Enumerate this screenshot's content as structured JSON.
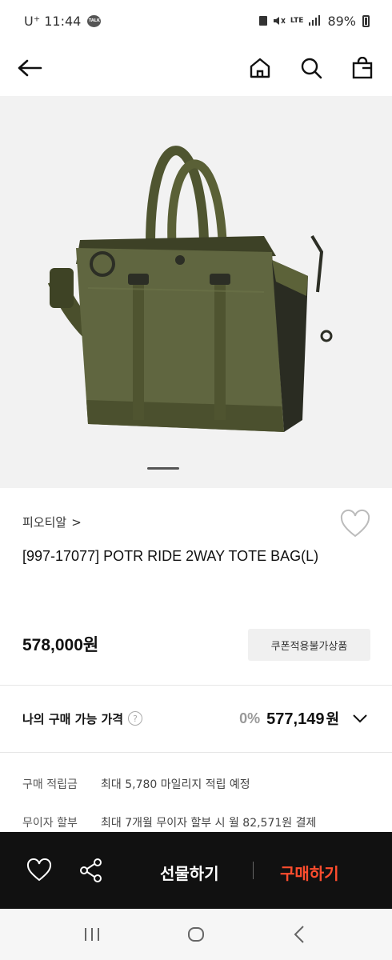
{
  "status_bar": {
    "carrier_time": "U⁺ 11:44",
    "talk_icon": "TALK",
    "network": "LTE",
    "battery": "89%"
  },
  "header": {
    "icons": [
      "back-arrow-icon",
      "home-icon",
      "search-icon",
      "shopping-bag-icon"
    ]
  },
  "product": {
    "brand": "피오티알",
    "brand_chevron": ">",
    "title": "[997-17077] POTR RIDE 2WAY TOTE BAG(L)",
    "price": "578,000원",
    "coupon_badge": "쿠폰적용불가상품",
    "bag_color": "#5e6339"
  },
  "my_price": {
    "label": "나의 구매 가능 가격",
    "help": "?",
    "discount": "0%",
    "value": "577,149",
    "unit": "원"
  },
  "info_rows": [
    {
      "label": "구매 적립금",
      "value": "최대 5,780 마일리지 적립 예정"
    },
    {
      "label": "무이자 할부",
      "value": "최대 7개월 무이자 할부 시 월 82,571원 결제"
    }
  ],
  "actions": {
    "gift": "선물하기",
    "buy": "구매하기",
    "buy_color": "#ff4d2e"
  },
  "nav": {
    "icons": [
      "recent-apps-icon",
      "home-circle-icon",
      "back-chevron-icon"
    ]
  }
}
